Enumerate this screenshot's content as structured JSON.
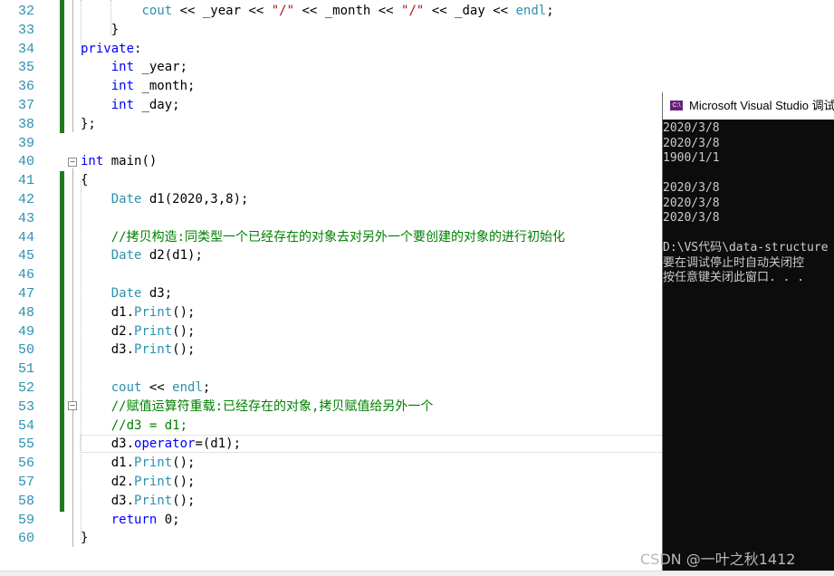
{
  "editor": {
    "lines": [
      {
        "n": "32",
        "t": "        cout << _year << \"/\" << _month << \"/\" << _day << endl;"
      },
      {
        "n": "33",
        "t": "    }"
      },
      {
        "n": "34",
        "t": "private:"
      },
      {
        "n": "35",
        "t": "    int _year;"
      },
      {
        "n": "36",
        "t": "    int _month;"
      },
      {
        "n": "37",
        "t": "    int _day;"
      },
      {
        "n": "38",
        "t": "};"
      },
      {
        "n": "39",
        "t": ""
      },
      {
        "n": "40",
        "t": "int main()"
      },
      {
        "n": "41",
        "t": "{"
      },
      {
        "n": "42",
        "t": "    Date d1(2020,3,8);"
      },
      {
        "n": "43",
        "t": ""
      },
      {
        "n": "44",
        "t": "    //拷贝构造:同类型一个已经存在的对象去对另外一个要创建的对象的进行初始化"
      },
      {
        "n": "45",
        "t": "    Date d2(d1);"
      },
      {
        "n": "46",
        "t": ""
      },
      {
        "n": "47",
        "t": "    Date d3;"
      },
      {
        "n": "48",
        "t": "    d1.Print();"
      },
      {
        "n": "49",
        "t": "    d2.Print();"
      },
      {
        "n": "50",
        "t": "    d3.Print();"
      },
      {
        "n": "51",
        "t": ""
      },
      {
        "n": "52",
        "t": "    cout << endl;"
      },
      {
        "n": "53",
        "t": "    //赋值运算符重载:已经存在的对象,拷贝赋值给另外一个"
      },
      {
        "n": "54",
        "t": "    //d3 = d1;"
      },
      {
        "n": "55",
        "t": "    d3.operator=(d1);"
      },
      {
        "n": "56",
        "t": "    d1.Print();"
      },
      {
        "n": "57",
        "t": "    d2.Print();"
      },
      {
        "n": "58",
        "t": "    d3.Print();"
      },
      {
        "n": "59",
        "t": "    return 0;"
      },
      {
        "n": "60",
        "t": "}"
      }
    ]
  },
  "console": {
    "icon_label": "C:\\",
    "title": "Microsoft Visual Studio 调试",
    "output": [
      "2020/3/8",
      "2020/3/8",
      "1900/1/1",
      "",
      "2020/3/8",
      "2020/3/8",
      "2020/3/8",
      "",
      "D:\\VS代码\\data-structure",
      "要在调试停止时自动关闭控",
      "按任意键关闭此窗口. . ."
    ]
  },
  "watermark": "CSDN @一叶之秋1412",
  "colors": {
    "keyword": "#0000ff",
    "type": "#2b91af",
    "string": "#a31515",
    "comment": "#008000",
    "line_number": "#2b91af",
    "change_bar": "#1e7a1e",
    "console_bg": "#0c0c0c"
  }
}
